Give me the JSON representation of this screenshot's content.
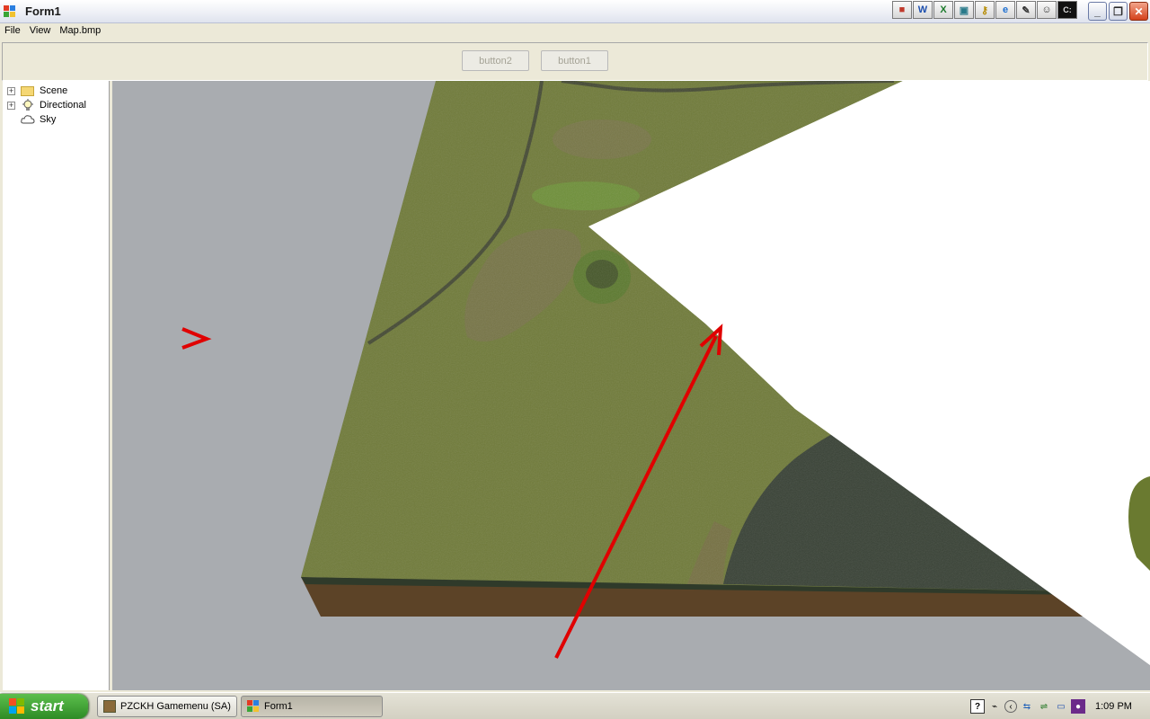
{
  "window": {
    "title": "Form1"
  },
  "quicklaunch": [
    {
      "icon": "palette-icon",
      "glyph": "■"
    },
    {
      "icon": "word-icon",
      "glyph": "W"
    },
    {
      "icon": "excel-icon",
      "glyph": "X"
    },
    {
      "icon": "monitor-icon",
      "glyph": "▣"
    },
    {
      "icon": "key-icon",
      "glyph": "⚷"
    },
    {
      "icon": "ie-icon",
      "glyph": "e"
    },
    {
      "icon": "paint-icon",
      "glyph": "✎"
    },
    {
      "icon": "chat-icon",
      "glyph": "☺"
    },
    {
      "icon": "cmd-icon",
      "glyph": "C:"
    }
  ],
  "menu": {
    "file": "File",
    "view": "View",
    "map": "Map.bmp"
  },
  "toolbar": {
    "button2": "button2",
    "button1": "button1"
  },
  "tree": {
    "items": [
      {
        "label": "Scene",
        "expandable": true,
        "icon": "folder-icon"
      },
      {
        "label": "Directional",
        "expandable": true,
        "icon": "lightbulb-icon"
      },
      {
        "label": "Sky",
        "expandable": false,
        "icon": "cloud-icon"
      }
    ]
  },
  "viewport": {
    "annotation_colors": {
      "marker": "#e00000"
    },
    "terrain_colors": {
      "grass": "#707b3a",
      "water": "#394236",
      "soil": "#5c4327"
    }
  },
  "taskbar": {
    "start_label": "start",
    "tasks": [
      {
        "label": "PZCKH Gamemenu (SA)",
        "active": false
      },
      {
        "label": "Form1",
        "active": true
      }
    ],
    "clock": "1:09 PM"
  }
}
